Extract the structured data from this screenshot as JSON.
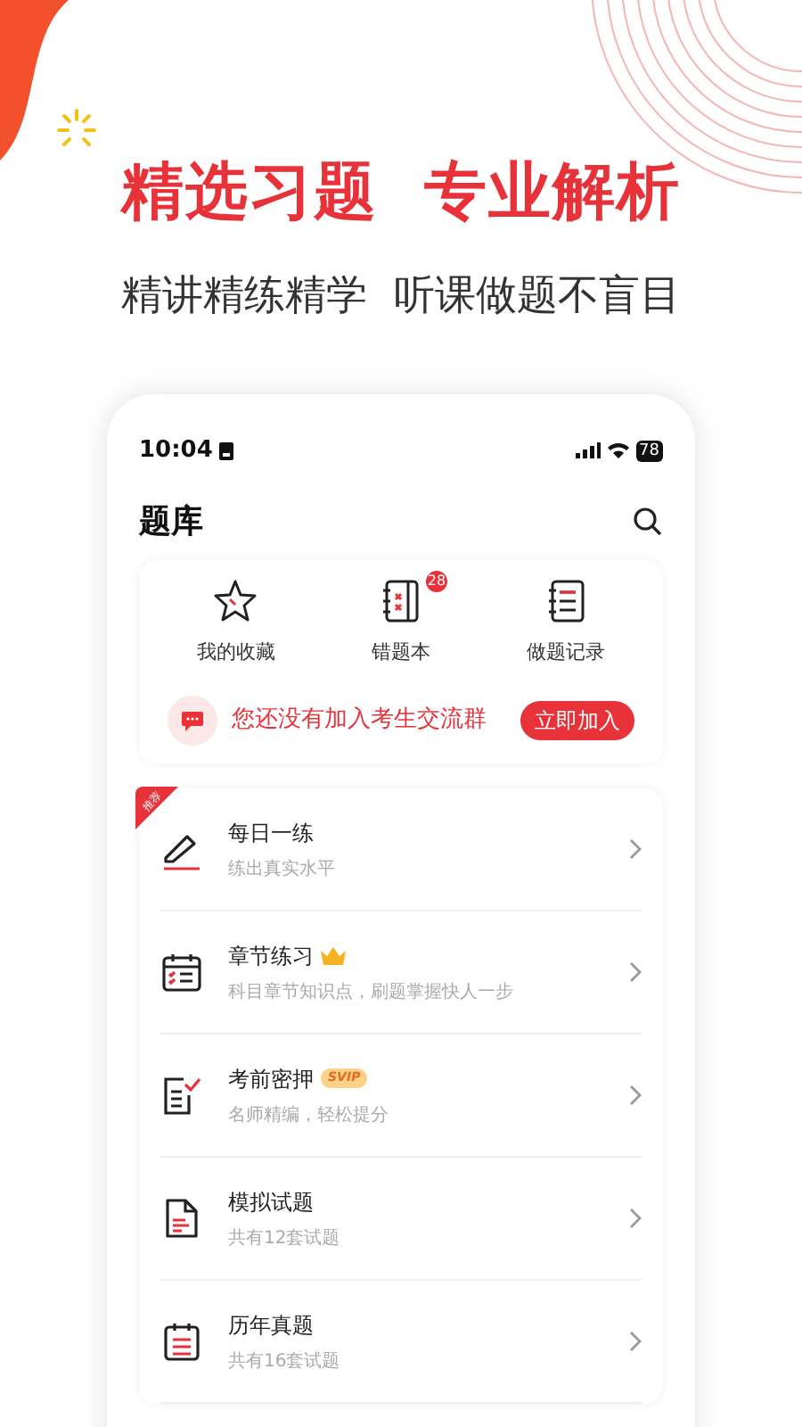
{
  "headline": "精选习题  专业解析",
  "subtitle": "精讲精练精学  听课做题不盲目",
  "status_bar": {
    "time": "10:04",
    "battery": "78"
  },
  "page_title": "题库",
  "shortcuts": [
    {
      "kind": "star",
      "label": "我的收藏"
    },
    {
      "kind": "wrongbook",
      "label": "错题本",
      "count": "28"
    },
    {
      "kind": "record",
      "label": "做题记录"
    }
  ],
  "group_banner": {
    "text": "您还没有加入考生交流群",
    "button": "立即加入"
  },
  "items": [
    {
      "kind": "pencil",
      "title": "每日一练",
      "subtitle": "练出真实水平",
      "ribbon": "推荐"
    },
    {
      "kind": "calendar",
      "title": "章节练习",
      "subtitle": "科目章节知识点，刷题掌握快人一步",
      "crown": true
    },
    {
      "kind": "checklist",
      "title": "考前密押",
      "subtitle": "名师精编，轻松提分",
      "svip_tag": "SVIP"
    },
    {
      "kind": "document",
      "title": "模拟试题",
      "subtitle": "共有12套试题"
    },
    {
      "kind": "calendar2",
      "title": "历年真题",
      "subtitle": "共有16套试题"
    }
  ]
}
